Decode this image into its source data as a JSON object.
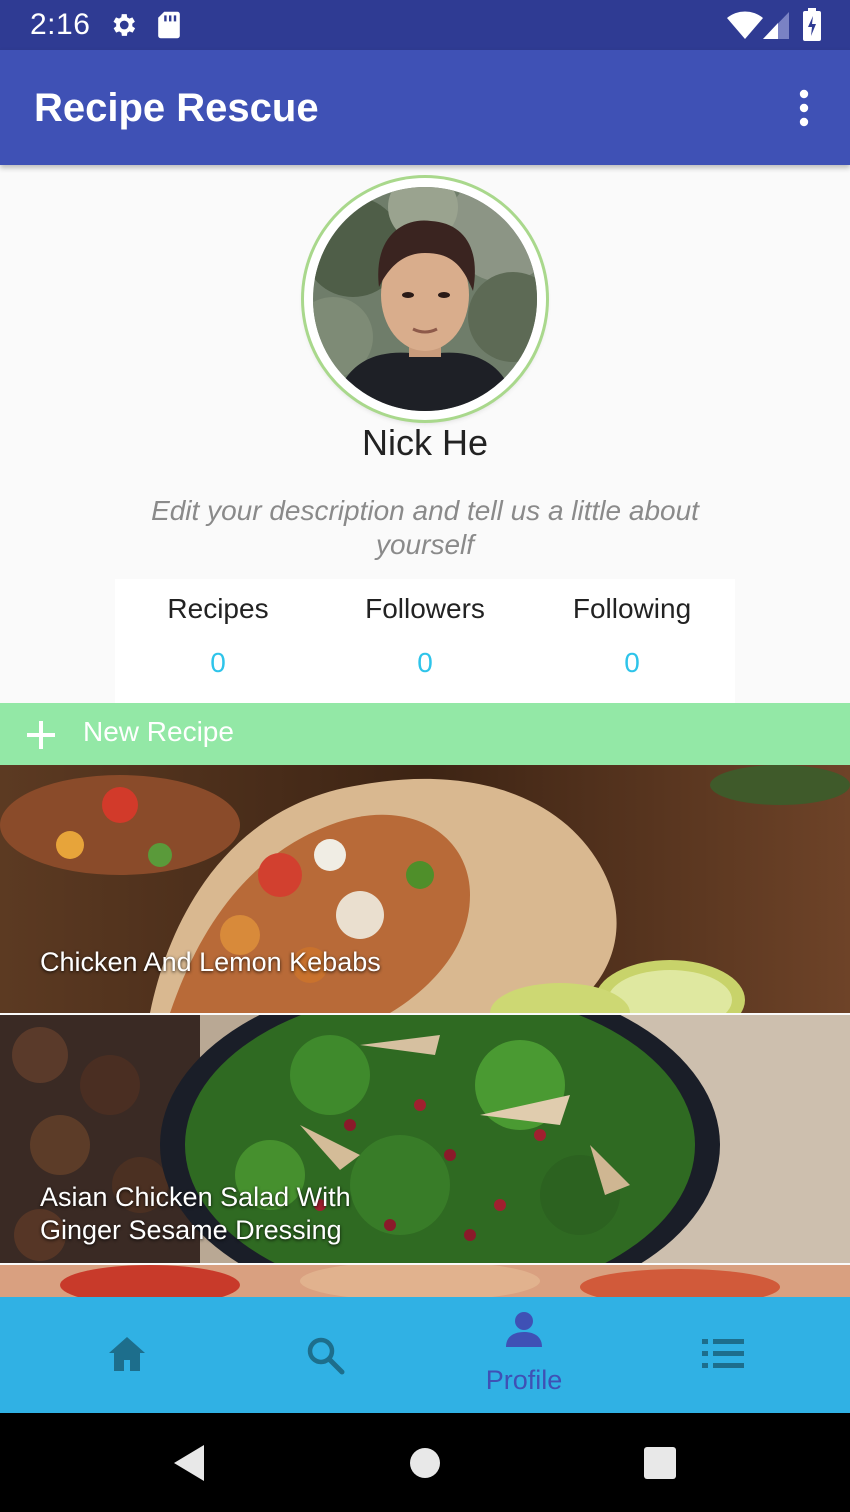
{
  "status_bar": {
    "time": "2:16",
    "icons": [
      "gear-icon",
      "sd-card-icon",
      "wifi-icon",
      "cell-signal-icon",
      "battery-icon"
    ]
  },
  "app_bar": {
    "title": "Recipe Rescue",
    "menu_icon": "more-vert-icon"
  },
  "profile": {
    "name": "Nick He",
    "description": "Edit your description and tell us a little about yourself",
    "ring_color": "#a9d88c"
  },
  "stats": [
    {
      "label": "Recipes",
      "value": "0"
    },
    {
      "label": "Followers",
      "value": "0"
    },
    {
      "label": "Following",
      "value": "0"
    }
  ],
  "new_recipe": {
    "label": "New Recipe",
    "icon": "plus-icon",
    "color": "#93e8a6"
  },
  "recipes": [
    {
      "title": "Chicken And Lemon Kebabs"
    },
    {
      "title": "Asian Chicken Salad With Ginger Sesame Dressing"
    }
  ],
  "bottom_nav": {
    "items": [
      {
        "icon": "home-icon",
        "label": ""
      },
      {
        "icon": "search-icon",
        "label": ""
      },
      {
        "icon": "person-icon",
        "label": "Profile"
      },
      {
        "icon": "list-icon",
        "label": ""
      }
    ],
    "active_index": 2
  },
  "colors": {
    "status_bar": "#2f3b93",
    "primary": "#3f51b5",
    "accent": "#2ec4ea",
    "bottom_nav": "#30b1e4"
  }
}
